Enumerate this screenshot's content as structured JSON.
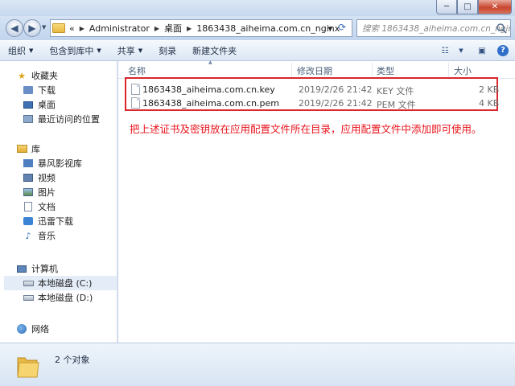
{
  "window": {
    "minimize": "─",
    "maximize": "□",
    "close": "✕"
  },
  "address": {
    "chevrons": "«",
    "crumbs": [
      "Administrator",
      "桌面",
      "1863438_aiheima.com.cn_nginx"
    ],
    "search_placeholder": "搜索 1863438_aiheima.com.cn_nginx"
  },
  "toolbar": {
    "organize": "组织",
    "include_in_library": "包含到库中",
    "share": "共享",
    "burn": "刻录",
    "new_folder": "新建文件夹"
  },
  "nav": {
    "favorites": "收藏夹",
    "downloads": "下载",
    "desktop": "桌面",
    "recent": "最近访问的位置",
    "libraries": "库",
    "storm": "暴风影视库",
    "videos": "视频",
    "pictures": "图片",
    "documents": "文档",
    "thunder": "迅雷下载",
    "music": "音乐",
    "computer": "计算机",
    "drive_c": "本地磁盘 (C:)",
    "drive_d": "本地磁盘 (D:)",
    "network": "网络"
  },
  "columns": {
    "name": "名称",
    "modified": "修改日期",
    "type": "类型",
    "size": "大小"
  },
  "files": [
    {
      "name": "1863438_aiheima.com.cn.key",
      "modified": "2019/2/26 21:42",
      "type": "KEY 文件",
      "size": "2 KB"
    },
    {
      "name": "1863438_aiheima.com.cn.pem",
      "modified": "2019/2/26 21:42",
      "type": "PEM 文件",
      "size": "4 KB"
    }
  ],
  "annotation": "把上述证书及密钥放在应用配置文件所在目录，应用配置文件中添加即可使用。",
  "status": {
    "count": "2 个对象"
  },
  "colors": {
    "highlight_box": "#d9262b",
    "annotation_text": "#e8141c",
    "selected_nav": "#e3ecf7"
  }
}
